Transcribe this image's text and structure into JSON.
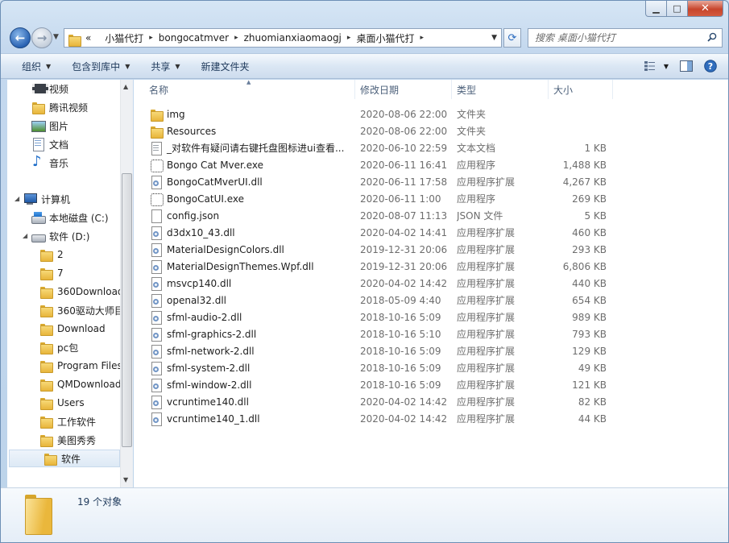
{
  "window": {
    "caption": {
      "minimize": "▁",
      "maximize": "□",
      "close": "✕"
    }
  },
  "nav": {
    "back": "←",
    "forward": "→",
    "breadcrumb": [
      "小猫代打",
      "bongocatmver",
      "zhuomianxiaomaogj",
      "桌面小猫代打"
    ],
    "overflow": "«",
    "search_placeholder": "搜索 桌面小猫代打"
  },
  "toolbar": {
    "organize": "组织",
    "include_in_library": "包含到库中",
    "share": "共享",
    "new_folder": "新建文件夹"
  },
  "navpane": {
    "libraries": [
      {
        "label": "视频",
        "icon": "video-icon"
      },
      {
        "label": "腾讯视频",
        "icon": "folder-icon"
      },
      {
        "label": "图片",
        "icon": "pictures-icon"
      },
      {
        "label": "文档",
        "icon": "documents-icon"
      },
      {
        "label": "音乐",
        "icon": "music-icon"
      }
    ],
    "computer": "计算机",
    "drive_c": "本地磁盘 (C:)",
    "drive_d": "软件 (D:)",
    "d_folders": [
      "2",
      "7",
      "360Download",
      "360驱动大师目",
      "Download",
      "pc包",
      "Program Files",
      "QMDownload",
      "Users",
      "工作软件",
      "美图秀秀",
      "软件"
    ]
  },
  "columns": {
    "name": "名称",
    "date": "修改日期",
    "type": "类型",
    "size": "大小"
  },
  "files": [
    {
      "name": "img",
      "date": "2020-08-06 22:00",
      "type": "文件夹",
      "size": "",
      "icon": "folder"
    },
    {
      "name": "Resources",
      "date": "2020-08-06 22:00",
      "type": "文件夹",
      "size": "",
      "icon": "folder"
    },
    {
      "name": "_对软件有疑问请右键托盘图标进ui查看...",
      "date": "2020-06-10 22:59",
      "type": "文本文档",
      "size": "1 KB",
      "icon": "doc"
    },
    {
      "name": "Bongo Cat Mver.exe",
      "date": "2020-06-11 16:41",
      "type": "应用程序",
      "size": "1,488 KB",
      "icon": "exe"
    },
    {
      "name": "BongoCatMverUI.dll",
      "date": "2020-06-11 17:58",
      "type": "应用程序扩展",
      "size": "4,267 KB",
      "icon": "dll"
    },
    {
      "name": "BongoCatUI.exe",
      "date": "2020-06-11 1:00",
      "type": "应用程序",
      "size": "269 KB",
      "icon": "exe"
    },
    {
      "name": "config.json",
      "date": "2020-08-07 11:13",
      "type": "JSON 文件",
      "size": "5 KB",
      "icon": "blank"
    },
    {
      "name": "d3dx10_43.dll",
      "date": "2020-04-02 14:41",
      "type": "应用程序扩展",
      "size": "460 KB",
      "icon": "dll"
    },
    {
      "name": "MaterialDesignColors.dll",
      "date": "2019-12-31 20:06",
      "type": "应用程序扩展",
      "size": "293 KB",
      "icon": "dll"
    },
    {
      "name": "MaterialDesignThemes.Wpf.dll",
      "date": "2019-12-31 20:06",
      "type": "应用程序扩展",
      "size": "6,806 KB",
      "icon": "dll"
    },
    {
      "name": "msvcp140.dll",
      "date": "2020-04-02 14:42",
      "type": "应用程序扩展",
      "size": "440 KB",
      "icon": "dll"
    },
    {
      "name": "openal32.dll",
      "date": "2018-05-09 4:40",
      "type": "应用程序扩展",
      "size": "654 KB",
      "icon": "dll"
    },
    {
      "name": "sfml-audio-2.dll",
      "date": "2018-10-16 5:09",
      "type": "应用程序扩展",
      "size": "989 KB",
      "icon": "dll"
    },
    {
      "name": "sfml-graphics-2.dll",
      "date": "2018-10-16 5:10",
      "type": "应用程序扩展",
      "size": "793 KB",
      "icon": "dll"
    },
    {
      "name": "sfml-network-2.dll",
      "date": "2018-10-16 5:09",
      "type": "应用程序扩展",
      "size": "129 KB",
      "icon": "dll"
    },
    {
      "name": "sfml-system-2.dll",
      "date": "2018-10-16 5:09",
      "type": "应用程序扩展",
      "size": "49 KB",
      "icon": "dll"
    },
    {
      "name": "sfml-window-2.dll",
      "date": "2018-10-16 5:09",
      "type": "应用程序扩展",
      "size": "121 KB",
      "icon": "dll"
    },
    {
      "name": "vcruntime140.dll",
      "date": "2020-04-02 14:42",
      "type": "应用程序扩展",
      "size": "82 KB",
      "icon": "dll"
    },
    {
      "name": "vcruntime140_1.dll",
      "date": "2020-04-02 14:42",
      "type": "应用程序扩展",
      "size": "44 KB",
      "icon": "dll"
    }
  ],
  "details": {
    "count": "19 个对象"
  },
  "colors": {
    "accent": "#1e395b",
    "close": "#c7452c",
    "frame": "#bcd3ea"
  }
}
